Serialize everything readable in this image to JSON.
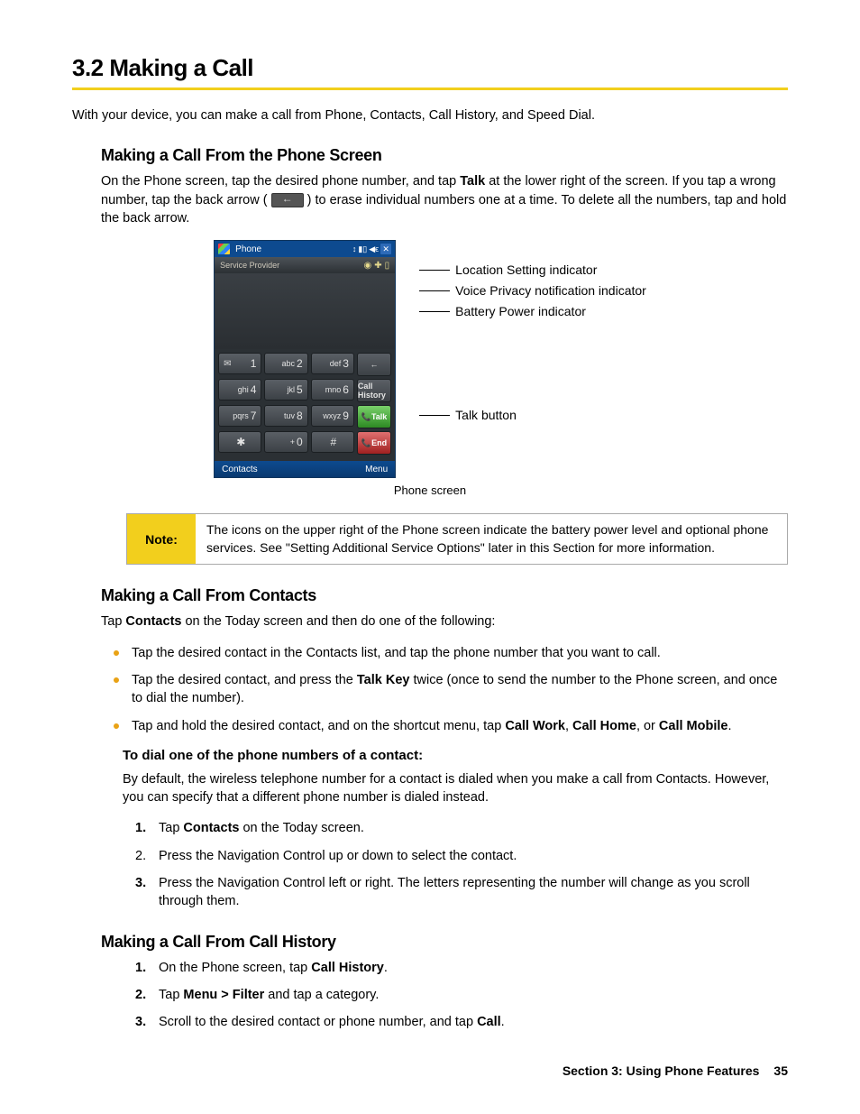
{
  "title": "3.2  Making a Call",
  "intro": "With your device, you can make a call from Phone, Contacts, Call History, and Speed Dial.",
  "s1": {
    "head": "Making a Call From the Phone Screen",
    "p_a": "On the Phone screen, tap the desired phone number, and tap ",
    "talk": "Talk",
    "p_b": " at the lower right of the screen. If you tap a wrong number, tap the back arrow ( ",
    "p_c": " ) to erase individual numbers one at a time. To delete all the numbers, tap and hold the back arrow."
  },
  "phone": {
    "title": "Phone",
    "provider": "Service Provider",
    "keys": {
      "k1": "1",
      "k2_sub": "abc",
      "k2": "2",
      "k3_sub": "def",
      "k3": "3",
      "k4_sub": "ghi",
      "k4": "4",
      "k5_sub": "jkl",
      "k5": "5",
      "k6_sub": "mno",
      "k6": "6",
      "k7_sub": "pqrs",
      "k7": "7",
      "k8_sub": "tuv",
      "k8": "8",
      "k9_sub": "wxyz",
      "k9": "9",
      "star": "✱",
      "k0_sub": "+",
      "k0": "0",
      "hash": "#",
      "history": "Call History",
      "talk": "Talk",
      "end": "End",
      "back": "←"
    },
    "soft_left": "Contacts",
    "soft_right": "Menu"
  },
  "callouts": {
    "c1": "Location Setting indicator",
    "c2": "Voice Privacy notification indicator",
    "c3": "Battery Power indicator",
    "c4": "Talk button"
  },
  "caption": "Phone screen",
  "note": {
    "label": "Note:",
    "body": "The icons on the upper right of the Phone screen indicate the battery power level and optional phone services. See \"Setting Additional Service Options\" later in this Section for more information."
  },
  "s2": {
    "head": "Making a Call From Contacts",
    "p_a": "Tap ",
    "contacts": "Contacts",
    "p_b": " on the Today screen and then do one of the following:",
    "b1": "Tap the desired contact in the Contacts list, and tap the phone number that you want to call.",
    "b2_a": "Tap the desired contact, and press the ",
    "b2_key": "Talk Key",
    "b2_b": " twice (once to send the number to the Phone screen, and once to dial the number).",
    "b3_a": "Tap and hold the desired contact, and on the shortcut menu, tap ",
    "b3_w": "Call Work",
    "b3_sep1": ", ",
    "b3_h": "Call Home",
    "b3_sep2": ", or ",
    "b3_m": "Call Mobile",
    "b3_end": ".",
    "step_head": "To dial one of the phone numbers of a contact:",
    "step_intro": "By default, the wireless telephone number for a contact is dialed when you make a call from Contacts. However, you can specify that a different phone number is dialed instead.",
    "st1_a": "Tap ",
    "st1_b": "Contacts",
    "st1_c": " on the Today screen.",
    "st2": "Press the Navigation Control up or down to select the contact.",
    "st3": "Press the Navigation Control left or right. The letters representing the number will change as you scroll through them."
  },
  "s3": {
    "head": "Making a Call From Call History",
    "st1_a": "On the Phone screen, tap ",
    "st1_b": "Call History",
    "st1_c": ".",
    "st2_a": "Tap ",
    "st2_b": "Menu > Filter",
    "st2_c": " and tap a category.",
    "st3_a": "Scroll to the desired contact or phone number, and tap ",
    "st3_b": "Call",
    "st3_c": "."
  },
  "footer": {
    "section": "Section 3: Using Phone Features",
    "page": "35"
  }
}
